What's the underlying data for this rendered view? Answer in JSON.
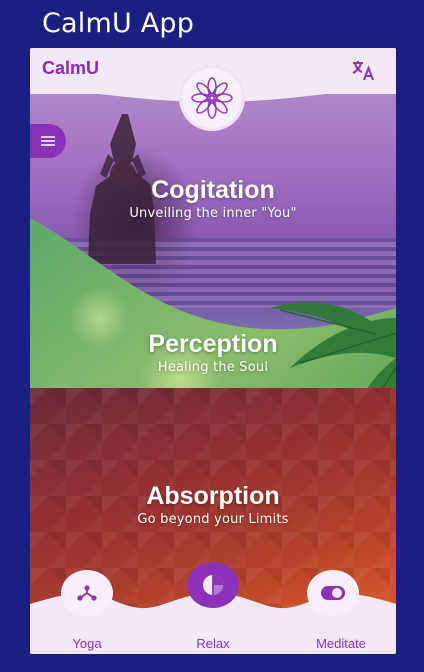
{
  "caption": "CalmU App",
  "app": {
    "brand": "CalmU",
    "translate_icon": "translate-icon",
    "logo_icon": "mandala-logo-icon",
    "menu_icon": "menu-icon"
  },
  "sections": [
    {
      "title": "Cogitation",
      "subtitle": "Unveiling the inner \"You\""
    },
    {
      "title": "Perception",
      "subtitle": "Healing the Soul"
    },
    {
      "title": "Absorption",
      "subtitle": "Go beyond your Limits"
    }
  ],
  "bottom_nav": [
    {
      "label": "Yoga",
      "icon": "yoga-nodes-icon",
      "active": false
    },
    {
      "label": "Relax",
      "icon": "pie-chart-icon",
      "active": true
    },
    {
      "label": "Meditate",
      "icon": "toggle-icon",
      "active": false
    }
  ],
  "colors": {
    "accent": "#8d31b6",
    "header_bg": "#f3e9f6",
    "page_bg": "#1b2080"
  }
}
